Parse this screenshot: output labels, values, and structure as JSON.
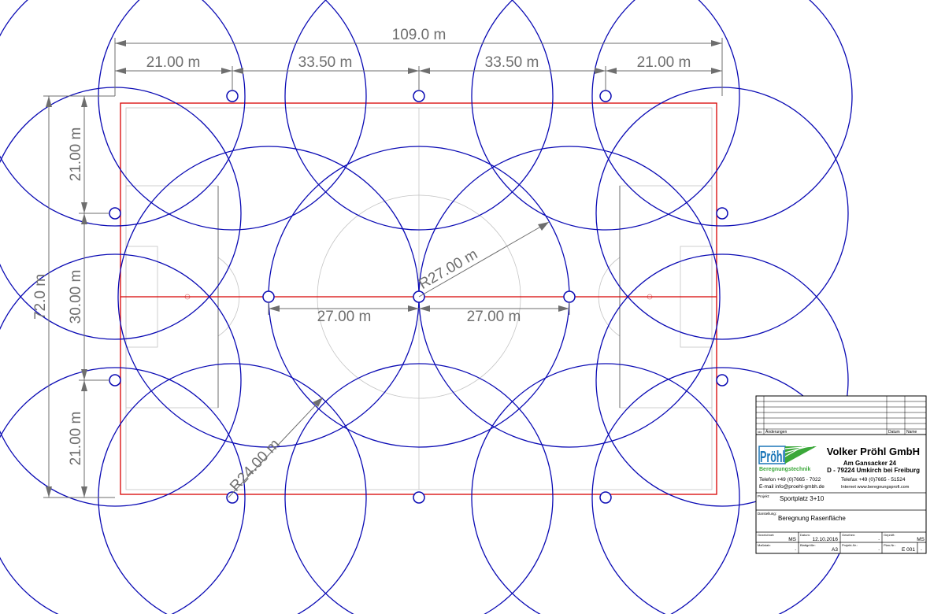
{
  "dimensions": {
    "total_width": "109.0 m",
    "top_segments": [
      "21.00 m",
      "33.50 m",
      "33.50 m",
      "21.00 m"
    ],
    "total_height": "72.0 m",
    "left_segments": [
      "21.00 m",
      "30.00 m",
      "21.00 m"
    ],
    "center_left": "27.00 m",
    "center_right": "27.00 m",
    "radius_large": "R27.00 m",
    "radius_small": "R24.00 m"
  },
  "title_block": {
    "revisions_header": "Änderungen",
    "idx_label": "Idx",
    "date_label": "Datum",
    "name_label": "Name",
    "company_name": "Volker Pröhl GmbH",
    "street": "Am Gansacker 24",
    "city": "D - 79224 Umkirch bei Freiburg",
    "logo_text": "Pröhl",
    "logo_sub": "Beregnungstechnik",
    "phone": "Telefon +49 (0)7665 - 7022",
    "fax": "Telefax +49 (0)7665 - 51524",
    "email": "E-mail info@proehl-gmbh.de",
    "internet": "Internet www.beregnungsprofi.com",
    "project_label": "Projekt:",
    "project_value": "Sportplatz 3+10",
    "drawing_label": "Darstellung:",
    "drawing_value": "Beregnung Rasenfläche",
    "drawn_label": "Gezeichnet:",
    "drawn_value": "MS",
    "date_field_label": "Datum:",
    "date_field_value": "12.10.2016",
    "checked_label": "Geprüft:",
    "checked_value": "MS",
    "viewed_label": "Gesehen:",
    "viewed_value": "-",
    "scale_label": "Maßstab:",
    "scale_value": "-",
    "sheet_size_label": "Blattgröße:",
    "sheet_size_value": "A3",
    "project_no_label": "Projekt-Nr.:",
    "project_no_value": "-",
    "plan_no_label": "Plan-Nr.:",
    "plan_no_value": "E 001",
    "plan_index_value": "-"
  },
  "colors": {
    "sprinkler_blue": "#0a0ab4",
    "boundary_red": "#d80000",
    "dimension_gray": "#6e6e6e",
    "field_line_gray": "#bdbdbd",
    "logo_blue": "#1b76b8",
    "logo_green": "#3ba83a"
  }
}
